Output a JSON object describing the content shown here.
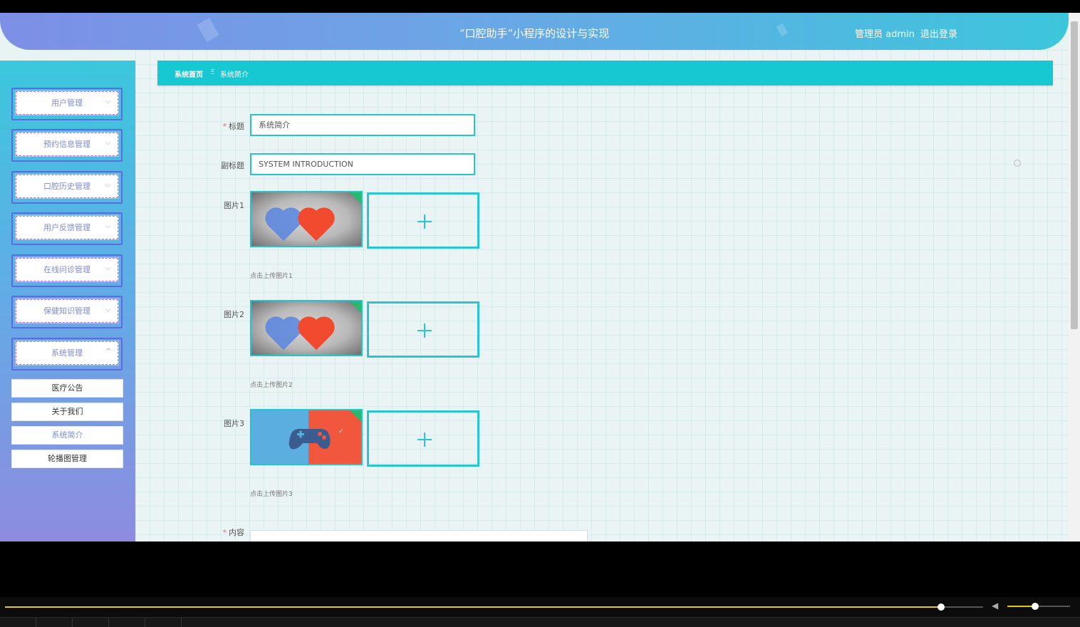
{
  "header": {
    "title": "“口腔助手”小程序的设计与实现",
    "user_role": "管理员 admin",
    "logout": "退出登录"
  },
  "sidebar": {
    "menus": [
      {
        "label": "用户管理",
        "expanded": false
      },
      {
        "label": "预约信息管理",
        "expanded": false
      },
      {
        "label": "口腔历史管理",
        "expanded": false
      },
      {
        "label": "用户反馈管理",
        "expanded": false
      },
      {
        "label": "在线问诊管理",
        "expanded": false
      },
      {
        "label": "保健知识管理",
        "expanded": false
      },
      {
        "label": "系统管理",
        "expanded": true
      }
    ],
    "submenus": [
      {
        "label": "医疗公告",
        "active": false
      },
      {
        "label": "关于我们",
        "active": false
      },
      {
        "label": "系统简介",
        "active": true
      },
      {
        "label": "轮播图管理",
        "active": false
      }
    ]
  },
  "breadcrumb": {
    "home": "系统首页",
    "separator": "Ξ",
    "current": "系统简介"
  },
  "form": {
    "title_label": "标题",
    "title_value": "系统简介",
    "subtitle_label": "副标题",
    "subtitle_value": "SYSTEM INTRODUCTION",
    "images": [
      {
        "label": "图片1",
        "hint": "点击上传图片1"
      },
      {
        "label": "图片2",
        "hint": "点击上传图片2"
      },
      {
        "label": "图片3",
        "hint": "点击上传图片3"
      }
    ],
    "content_label": "内容"
  },
  "video": {
    "progress": 0.957,
    "volume": 0.44
  },
  "colors": {
    "accent": "#17c8d2",
    "menu_frame": "#5b6be0",
    "yellow": "#e6c619"
  }
}
